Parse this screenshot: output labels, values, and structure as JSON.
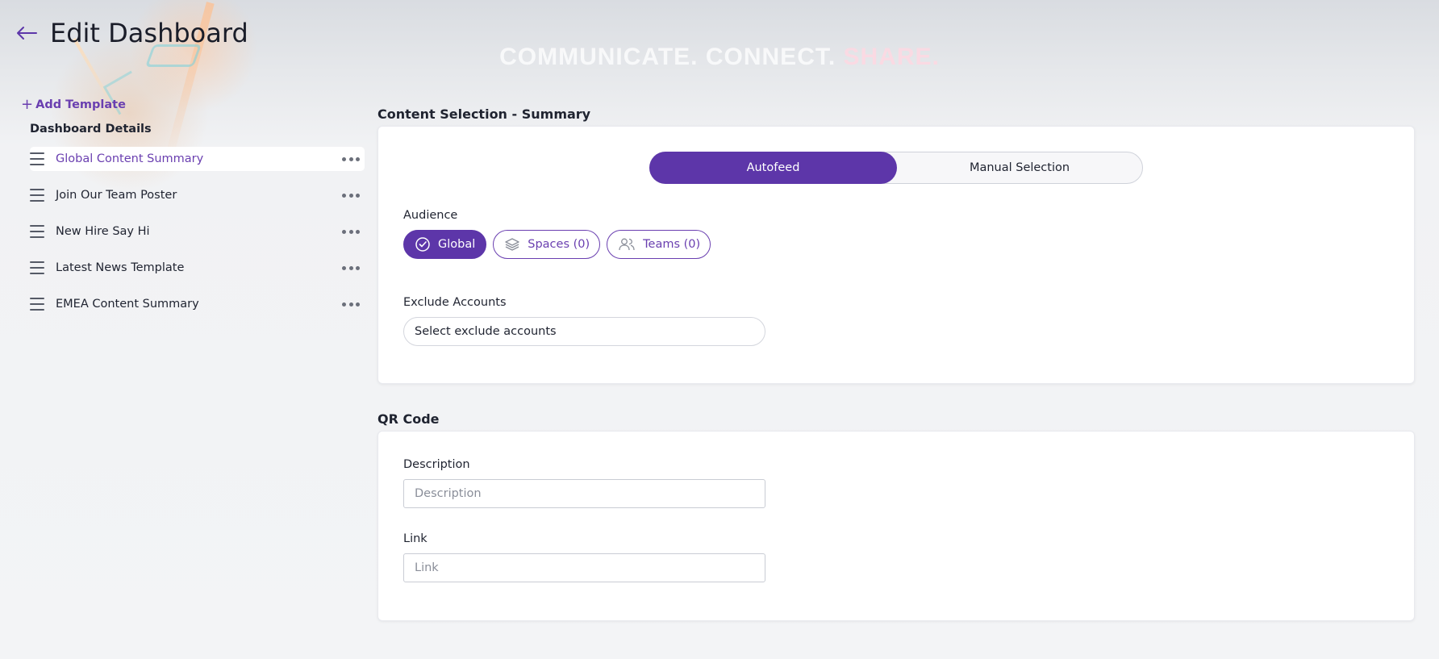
{
  "header": {
    "title": "Edit Dashboard",
    "back_icon": "arrow-left-icon"
  },
  "banner": {
    "part1": "COMMUNICATE. CONNECT. ",
    "part2": "SHARE."
  },
  "sidebar": {
    "add_template_label": "Add Template",
    "section_label": "Dashboard Details",
    "items": [
      {
        "label": "Global Content Summary",
        "active": true
      },
      {
        "label": "Join Our Team Poster",
        "active": false
      },
      {
        "label": "New Hire Say Hi",
        "active": false
      },
      {
        "label": "Latest News Template",
        "active": false
      },
      {
        "label": "EMEA Content Summary",
        "active": false
      }
    ]
  },
  "content_selection": {
    "title": "Content Selection - Summary",
    "toggle": {
      "autofeed": "Autofeed",
      "manual": "Manual Selection",
      "selected": "Autofeed"
    },
    "audience_label": "Audience",
    "audience_chips": {
      "global": "Global",
      "spaces": "Spaces (0)",
      "teams": "Teams (0)"
    },
    "exclude_label": "Exclude Accounts",
    "exclude_placeholder": "Select exclude accounts"
  },
  "qr_code": {
    "title": "QR Code",
    "description_label": "Description",
    "description_placeholder": "Description",
    "description_value": "",
    "link_label": "Link",
    "link_placeholder": "Link",
    "link_value": ""
  },
  "colors": {
    "accent": "#5d36a9",
    "accent_text": "#6a3fb0"
  }
}
